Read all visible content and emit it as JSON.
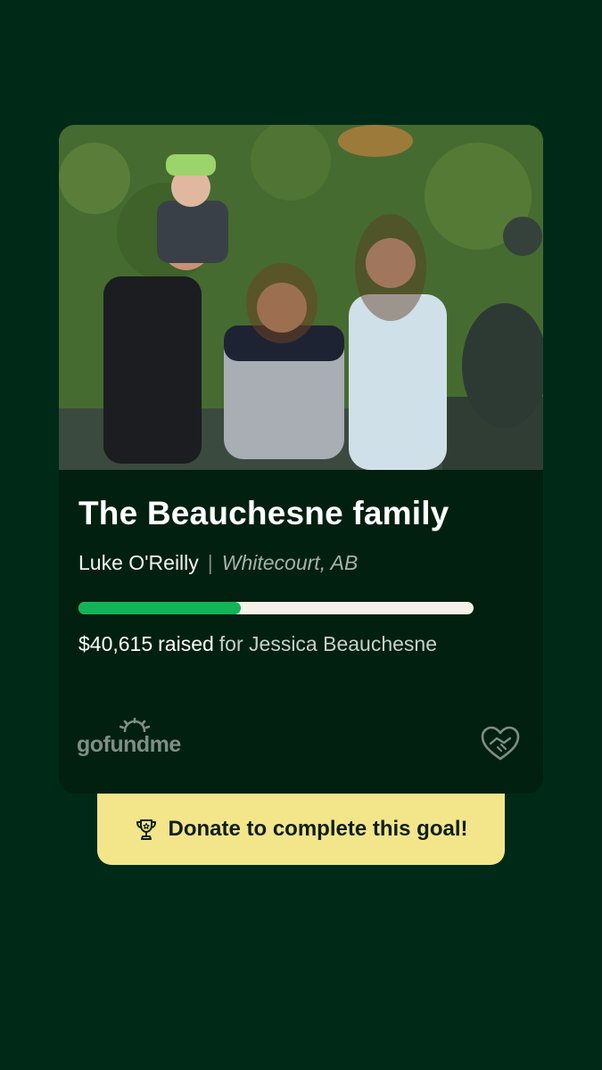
{
  "campaign": {
    "title": "The Beauchesne family",
    "organizer": "Luke O'Reilly",
    "separator": "|",
    "location": "Whitecourt, AB",
    "amount_raised": "$40,615",
    "raised_word": "raised",
    "beneficiary": "for Jessica Beauchesne",
    "progress_fraction": 0.41
  },
  "brand": {
    "logo_text": "gofundme",
    "logo_icon": "sun-rays-icon",
    "corner_icon": "heart-handshake-icon"
  },
  "cta": {
    "label": "Donate to complete this goal!",
    "icon": "trophy-icon"
  },
  "colors": {
    "background": "#002a18",
    "card": "#01200f",
    "progress_fill": "#11b557",
    "progress_track": "#f4f1e8",
    "cta_background": "#f3e58a"
  }
}
